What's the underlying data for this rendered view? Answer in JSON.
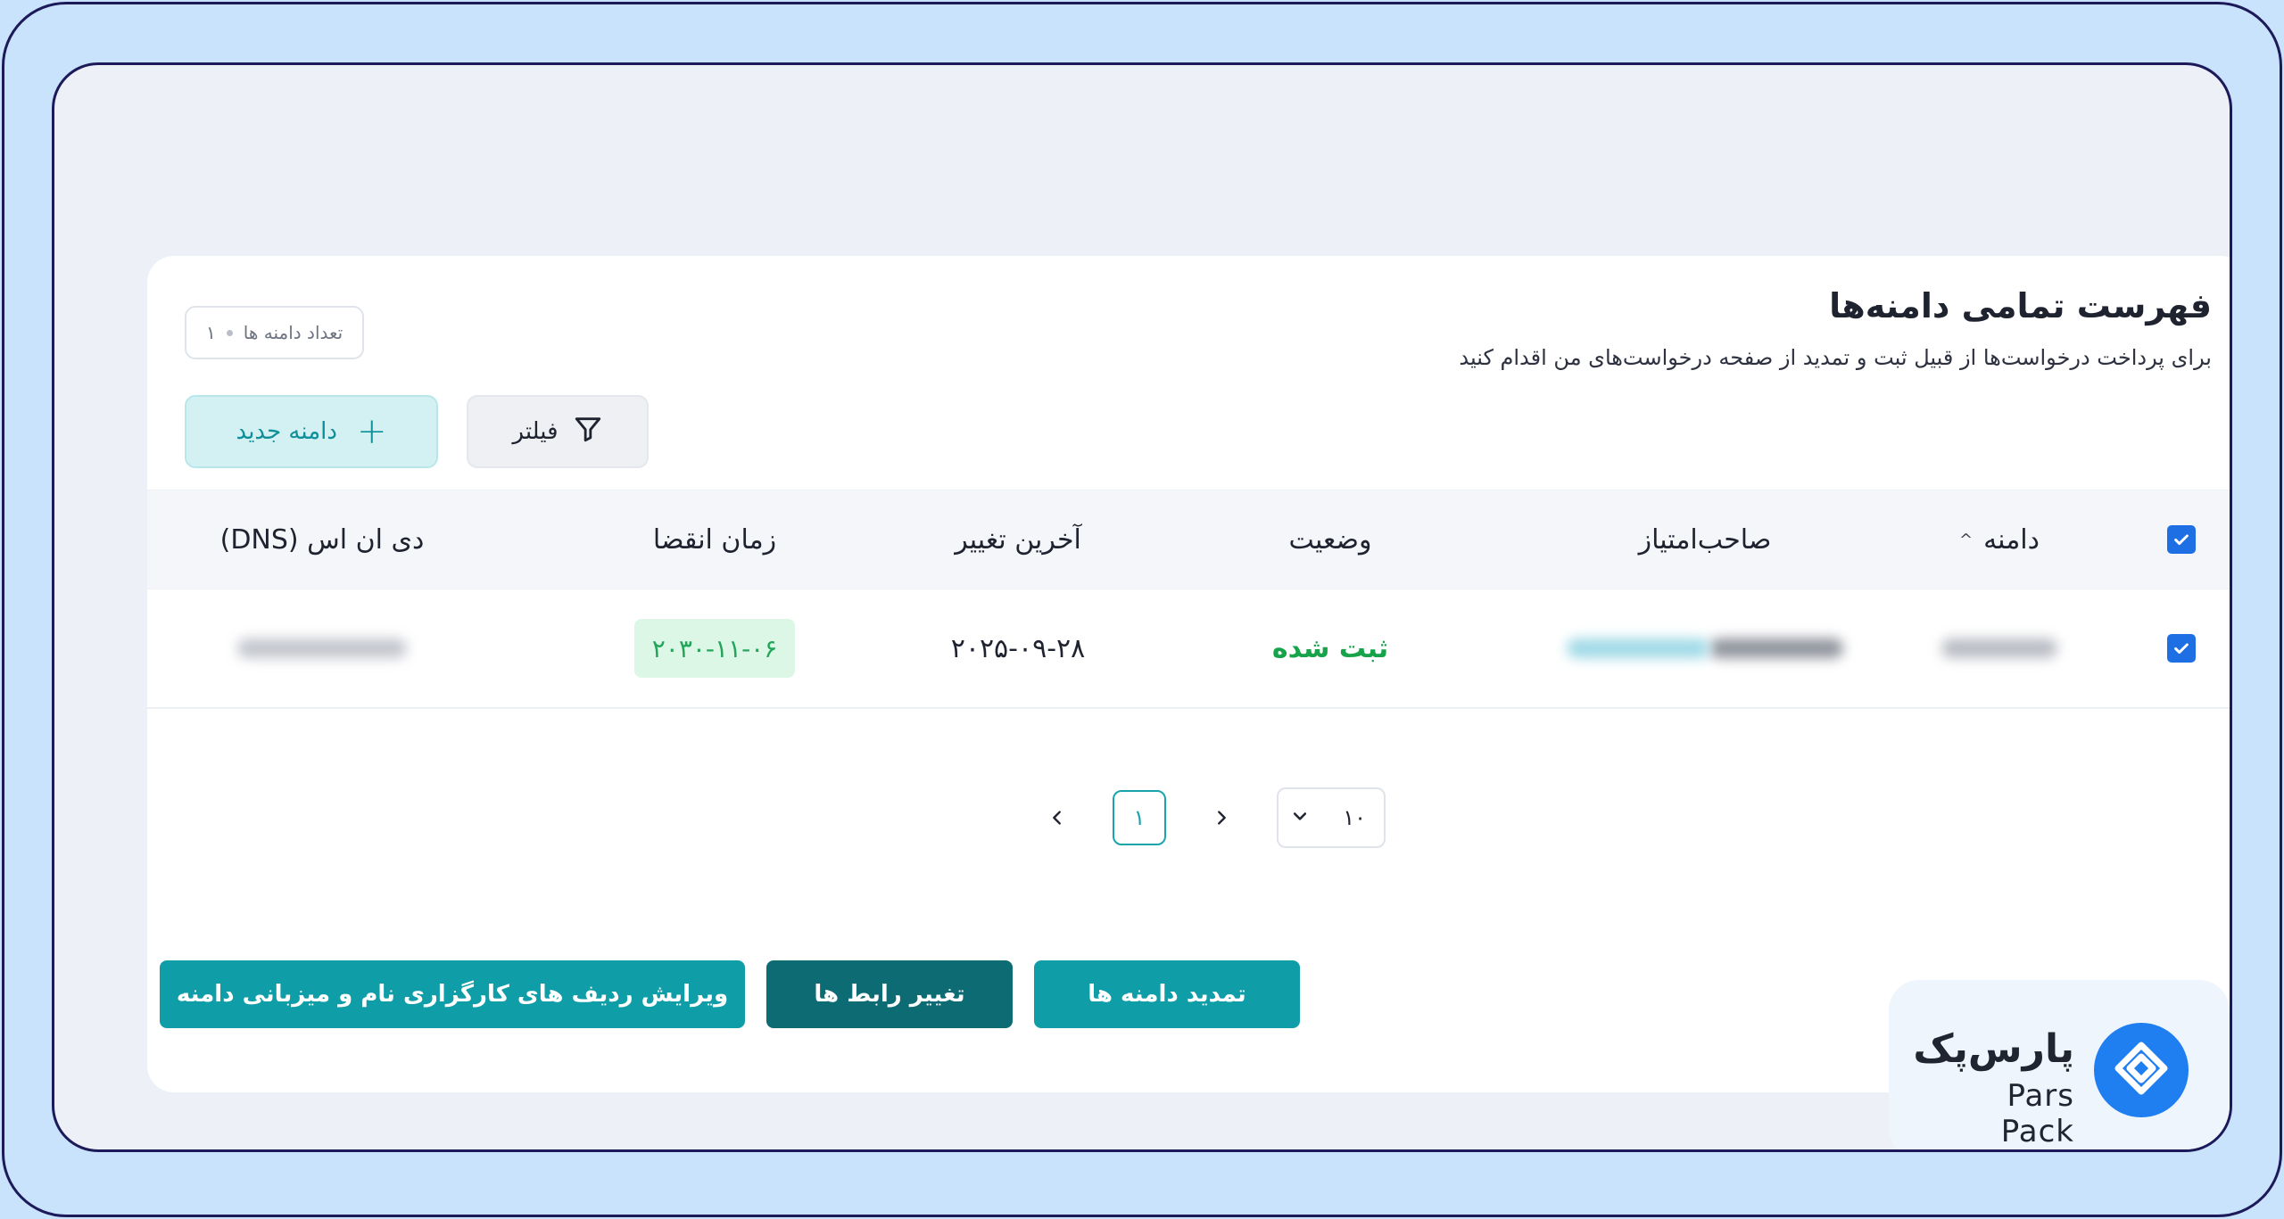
{
  "header": {
    "title": "فهرست تمامی دامنه‌ها",
    "subtitle": "برای پرداخت درخواست‌ها از قبیل ثبت و تمدید از صفحه درخواست‌های من اقدام کنید"
  },
  "summary": {
    "count_label": "تعداد دامنه ها",
    "count_value": "۱"
  },
  "toolbar": {
    "new_domain_label": "دامنه جدید",
    "filter_label": "فیلتر"
  },
  "table": {
    "columns": {
      "domain": "دامنه",
      "owner": "صاحب‌امتیاز",
      "status": "وضعیت",
      "last_change": "آخرین تغییر",
      "expiry": "زمان انقضا",
      "dns": "دی ان اس (DNS)"
    },
    "rows": [
      {
        "status": "ثبت شده",
        "last_change": "۲۰۲۵-۰۹-۲۸",
        "expiry": "۲۰۳۰-۱۱-۰۶"
      }
    ]
  },
  "pagination": {
    "current_page": "۱",
    "page_size": "۱۰"
  },
  "actions": {
    "renew_label": "تمدید دامنه ها",
    "transfer_label": "تغییر رابط ها",
    "edit_records_label": "ویرایش ردیف های کارگزاری نام و میزبانی دامنه"
  },
  "branding": {
    "logo_fa": "پارس‌پک",
    "logo_en": "Pars Pack",
    "accent_color": "#0f9ea8",
    "logo_color": "#1f7ef0"
  }
}
